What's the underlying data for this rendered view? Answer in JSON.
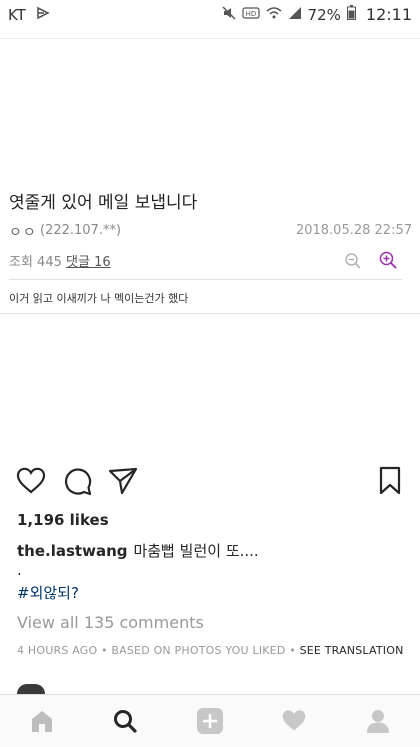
{
  "status_bar": {
    "carrier": "KT",
    "battery": "72%",
    "time": "12:11",
    "icons": [
      "cast-icon",
      "mute-icon",
      "hd-icon",
      "wifi-icon",
      "signal-icon",
      "battery-icon"
    ]
  },
  "post_image": {
    "forum_title": "엿줄게 있어 메일 보냅니다",
    "author": "ㅇㅇ",
    "ip": "(222.107.**)",
    "date": "2018.05.28 22:57",
    "views_label": "조회 445",
    "comments_label": "댓글 16",
    "body": "이거 읽고 이새끼가 나 멕이는건가 했다"
  },
  "post": {
    "likes": "1,196 likes",
    "username": "the.lastwang",
    "caption_text": "마춤뻡 빌런이 또....",
    "dot_line": ".",
    "hashtag": "#외않되?",
    "view_comments": "View all 135 comments",
    "meta_text": "4 HOURS AGO • BASED ON PHOTOS YOU LIKED • ",
    "see_translation": "SEE TRANSLATION"
  },
  "colors": {
    "hashtag": "#003569",
    "muted": "#999999",
    "zoom_in": "#9b2fae",
    "nav_inactive": "#bdbdbd",
    "nav_active": "#262626"
  },
  "nav": [
    "home-icon",
    "search-icon",
    "add-icon",
    "heart-icon",
    "profile-icon"
  ]
}
